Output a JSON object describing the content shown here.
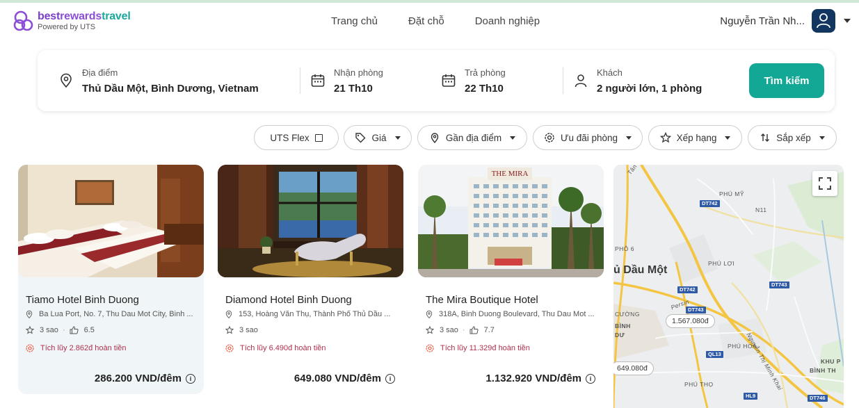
{
  "brand": {
    "name_part1": "best",
    "name_part2": "rewards",
    "name_part3": "travel",
    "subtitle": "Powered by UTS",
    "colors": {
      "purple": "#7a3ec8",
      "teal": "#13a896",
      "navy": "#12365f"
    }
  },
  "nav": {
    "items": [
      {
        "label": "Trang chủ"
      },
      {
        "label": "Đặt chỗ"
      },
      {
        "label": "Doanh nghiệp"
      }
    ]
  },
  "user": {
    "name": "Nguyễn Trần Nh...",
    "icon": "user-icon"
  },
  "search": {
    "location": {
      "label": "Địa điểm",
      "value": "Thủ Dầu Một, Bình Dương, Vietnam",
      "icon": "location-pin-icon"
    },
    "checkin": {
      "label": "Nhận phòng",
      "value": "21 Th10",
      "icon": "calendar-icon"
    },
    "checkout": {
      "label": "Trả phòng",
      "value": "22 Th10",
      "icon": "calendar-icon"
    },
    "guests": {
      "label": "Khách",
      "value": "2 người lớn, 1 phòng",
      "icon": "person-icon"
    },
    "button_label": "Tìm kiếm"
  },
  "filters": [
    {
      "label": "UTS Flex",
      "icon": "checkbox-icon"
    },
    {
      "label": "Giá",
      "icon": "tag-icon"
    },
    {
      "label": "Gần địa điểm",
      "icon": "location-pin-icon"
    },
    {
      "label": "Ưu đãi phòng",
      "icon": "badge-icon"
    },
    {
      "label": "Xếp hạng",
      "icon": "star-icon"
    },
    {
      "label": "Sắp xếp",
      "icon": "sort-icon"
    }
  ],
  "hotels": [
    {
      "name": "Tiamo Hotel Binh Duong",
      "address": "Ba Lua Port, No. 7, Thu Dau Mot City, Binh ...",
      "stars": "3 sao",
      "rating": "6.5",
      "reward": "Tích lũy 2.862đ hoàn tiền",
      "price": "286.200 VND/đêm"
    },
    {
      "name": "Diamond Hotel Binh Duong",
      "address": "153, Hoàng Văn Thụ, Thành Phố Thủ Dầu ...",
      "stars": "3 sao",
      "rating": "",
      "reward": "Tích lũy 6.490đ hoàn tiền",
      "price": "649.080 VND/đêm"
    },
    {
      "name": "The Mira Boutique Hotel",
      "address": "318A, Binh Duong Boulevard, Thu Dau Mot ...",
      "stars": "3 sao",
      "rating": "7.7",
      "reward": "Tích lũy 11.329đ hoàn tiền",
      "price": "1.132.920 VND/đêm",
      "photo_sign": "THE MIRA"
    }
  ],
  "map": {
    "labels": {
      "tan_van": "Tân Vạn - Mỹ Phước",
      "phu_my": "PHÚ MỸ",
      "n11": "N11",
      "phu_loi": "PHÚ LỢI",
      "phu_6": "PHÔ 6",
      "city": "ủ Dầu Một",
      "persin": "Persin",
      "cuong": "CƯỜNG",
      "binh_duong": "BÌNH DƯ",
      "phu_hoa": "PHÚ HOÀ",
      "nguyen_thi_minh_khai": "Nguyễn Thị Minh Khai",
      "khu_pho": "KHU P",
      "binh_th": "BÌNH TH",
      "phu_tho": "PHÚ THỌ"
    },
    "roads": [
      "DT742",
      "DT742",
      "DT743",
      "DT743",
      "QL13",
      "HL9",
      "DT746"
    ],
    "pins": [
      "1.567.080đ",
      "649.080đ"
    ]
  }
}
